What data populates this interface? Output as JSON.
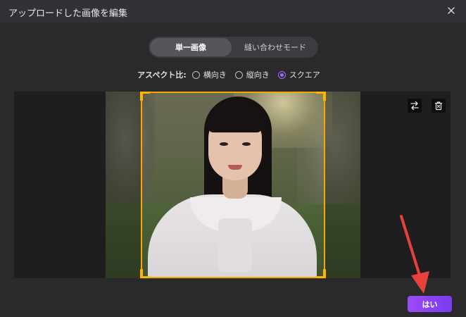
{
  "window": {
    "title": "アップロードした画像を編集"
  },
  "mode_toggle": {
    "single_label": "単一画像",
    "stitch_label": "縫い合わせモード"
  },
  "aspect": {
    "label": "アスペクト比:",
    "options": [
      {
        "label": "横向き",
        "selected": false
      },
      {
        "label": "縦向き",
        "selected": false
      },
      {
        "label": "スクエア",
        "selected": true
      }
    ]
  },
  "tools": {
    "swap_icon": "swap-arrows-icon",
    "trash_icon": "trash-icon"
  },
  "actions": {
    "confirm_label": "はい"
  },
  "colors": {
    "accent": "#a06cf5",
    "crop_frame": "#f5a800",
    "arrow": "#e8413c",
    "confirm_button": "#8a44f2"
  }
}
